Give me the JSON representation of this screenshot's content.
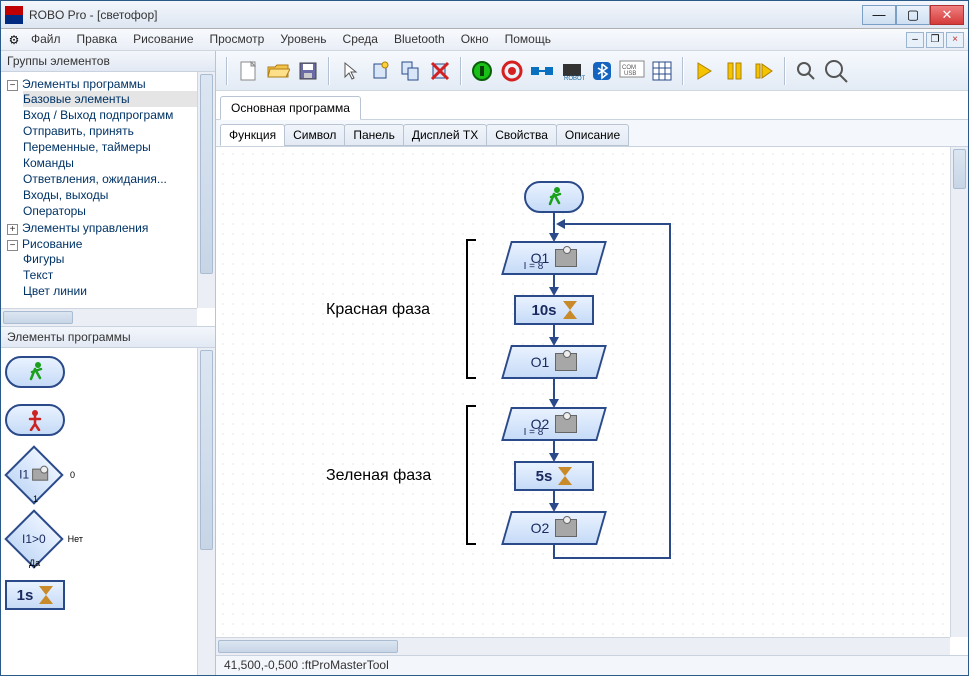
{
  "window": {
    "title": "ROBO Pro - [светофор]"
  },
  "menu": {
    "file": "Файл",
    "edit": "Правка",
    "draw": "Рисование",
    "view": "Просмотр",
    "level": "Уровень",
    "env": "Среда",
    "bluetooth": "Bluetooth",
    "window": "Окно",
    "help": "Помощь"
  },
  "left_panel": {
    "groups_title": "Группы элементов",
    "tree": {
      "root1": "Элементы программы",
      "basic": "Базовые элементы",
      "sub_io": "Вход / Выход подпрограмм",
      "send_recv": "Отправить, принять",
      "vars_timers": "Переменные, таймеры",
      "commands": "Команды",
      "branches": "Ответвления, ожидания...",
      "io": "Входы, выходы",
      "operators": "Операторы",
      "root2": "Элементы управления",
      "root3": "Рисование",
      "figures": "Фигуры",
      "text": "Текст",
      "line_color": "Цвет линии"
    },
    "palette_title": "Элементы программы",
    "palette": {
      "cond1": "I1",
      "cond1_out": "0",
      "cond1_yes": "1",
      "cond2": "I1>0",
      "cond2_no": "Нет",
      "cond2_yes": "Да",
      "delay": "1s"
    }
  },
  "program_tab": "Основная программа",
  "detail_tabs": {
    "t0": "Функция",
    "t1": "Символ",
    "t2": "Панель",
    "t3": "Дисплей TX",
    "t4": "Свойства",
    "t5": "Описание"
  },
  "flow": {
    "o1_on": "O1",
    "o1_on_sub": "I = 8",
    "delay1": "10s",
    "o1_off": "O1",
    "o2_on": "O2",
    "o2_on_sub": "I = 8",
    "delay2": "5s",
    "o2_off": "O2",
    "phase_red": "Красная фаза",
    "phase_green": "Зеленая фаза"
  },
  "status": "41,500,-0,500 :ftProMasterTool"
}
